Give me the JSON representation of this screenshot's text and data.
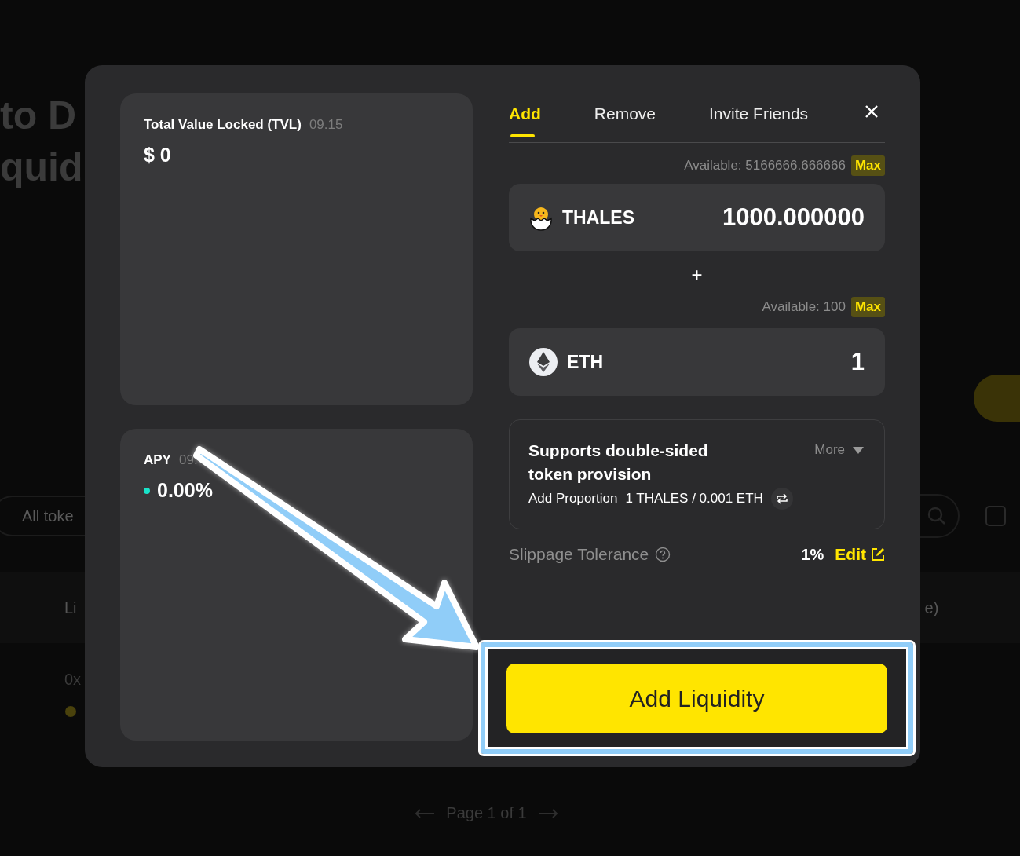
{
  "background": {
    "heading_lines": [
      "to D",
      "quid"
    ],
    "filter_field": {
      "placeholder": "All toke"
    },
    "table_header": [
      "Li",
      "e)"
    ],
    "row_text": "0x",
    "checkbox": {
      "checked": false
    },
    "pagination": "Page 1 of 1"
  },
  "modal": {
    "stats": [
      {
        "kind": "tvl",
        "label": "Total Value Locked (TVL)",
        "date": "09.15",
        "value": "$ 0"
      },
      {
        "kind": "apy",
        "label": "APY",
        "date": "09.",
        "value": "0.00%"
      }
    ],
    "tabs": [
      {
        "label": "Add",
        "selected": true
      },
      {
        "label": "Remove",
        "selected": false
      },
      {
        "label": "Invite Friends",
        "selected": false
      }
    ],
    "tokens": [
      {
        "kind": "chick",
        "available": "Available: 5166666.666666",
        "max": "Max",
        "symbol": "THALES",
        "amount": "1000.000000"
      },
      {
        "kind": "eth",
        "available": "Available: 100",
        "max": "Max",
        "symbol": "ETH",
        "amount": "1"
      }
    ],
    "separator": "+",
    "info": {
      "title": "Supports double-sided token provision",
      "more": "More",
      "proportion_label": "Add Proportion",
      "proportion": "1 THALES / 0.001 ETH"
    },
    "slippage": {
      "label": "Slippage Tolerance",
      "value": "1%",
      "edit": "Edit"
    },
    "submit": "Add Liquidity"
  }
}
